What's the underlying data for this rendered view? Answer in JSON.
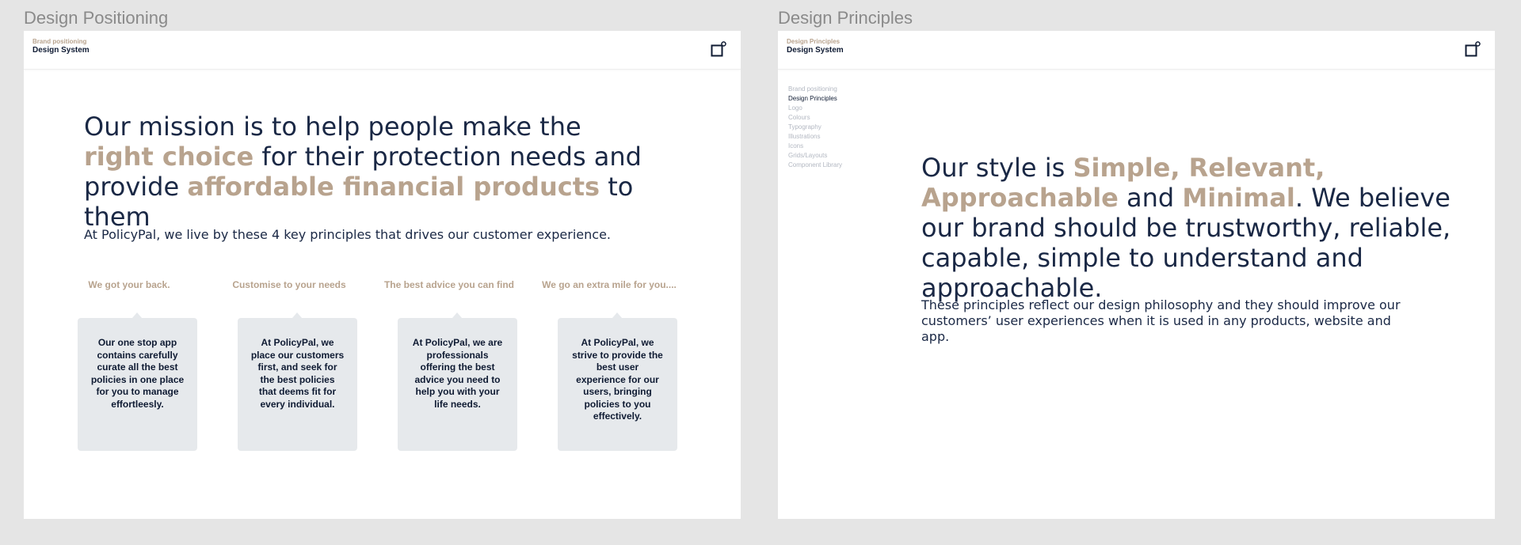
{
  "frames": [
    {
      "title": "Design Positioning",
      "header": {
        "subtitle": "Brand positioning",
        "title": "Design System"
      },
      "mission": {
        "part1": "Our mission is to help people make the ",
        "accent1": "right choice",
        "part2": " for their protection needs and provide ",
        "accent2": "affordable financial products",
        "part3": " to them"
      },
      "intro": "At PolicyPal, we live by these 4 key principles that drives our customer experience.",
      "principles": [
        {
          "title": "We got your back.",
          "text": "Our one stop app contains carefully curate all the best policies in one place for you to manage effortleesly."
        },
        {
          "title": "Customise to your needs",
          "text": "At PolicyPal, we place our customers first, and seek for the best policies that deems fit for every individual."
        },
        {
          "title": "The best advice you can find",
          "text": "At PolicyPal, we are professionals offering the best advice you need to help you with your life needs."
        },
        {
          "title": "We go an extra mile for you....",
          "text": "At PolicyPal, we strive to provide the best user experience for our users, bringing policies to you effectively."
        }
      ]
    },
    {
      "title": "Design Principles",
      "header": {
        "subtitle": "Design Principles",
        "title": "Design System"
      },
      "nav": [
        "Brand positioning",
        "Design Principles",
        "Logo",
        "Colours",
        "Typography",
        "Illustrations",
        "Icons",
        "Grids/Layouts",
        "Component Library"
      ],
      "style": {
        "part1": "Our style is ",
        "accent1": "Simple, Relevant, Approachable",
        "part2": " and ",
        "accent2": "Minimal",
        "part3": ". We believe our brand should be trustworthy, reliable, capable, simple to understand and approachable."
      },
      "philosophy": "These principles reflect our design philosophy and they should improve our customers’ user experiences when it is used in any products, website and app."
    }
  ],
  "colors": {
    "accent": "#b8a38e",
    "navy": "#1a2845",
    "card": "#e6e9ec",
    "canvas": "#e5e5e5"
  },
  "icons": {
    "header": "expand-window-icon"
  }
}
